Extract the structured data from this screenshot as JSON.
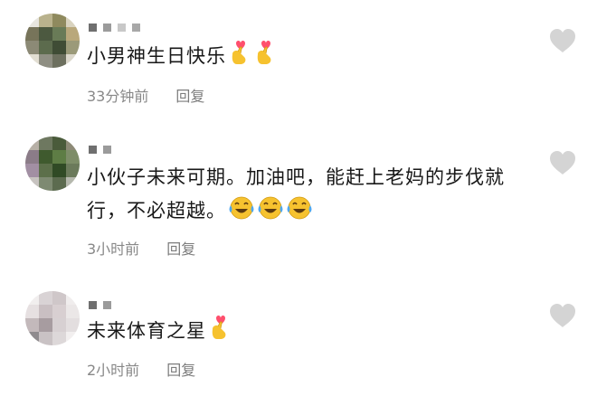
{
  "comments": [
    {
      "text": "小男神生日快乐",
      "time": "33分钟前",
      "reply_label": "回复",
      "emoji": [
        "finger-heart",
        "finger-heart"
      ]
    },
    {
      "text": "小伙子未来可期。加油吧，能赶上老妈的步伐就行，不必超越。",
      "time": "3小时前",
      "reply_label": "回复",
      "emoji": [
        "tears-of-joy",
        "tears-of-joy",
        "tears-of-joy"
      ]
    },
    {
      "text": "未来体育之星",
      "time": "2小时前",
      "reply_label": "回复",
      "emoji": [
        "finger-heart"
      ]
    }
  ],
  "colors": {
    "text": "#181818",
    "meta": "#888888",
    "like_icon": "#d4d4d4",
    "heart": "#ff4f6d",
    "emoji_yellow": "#f6c22f"
  }
}
